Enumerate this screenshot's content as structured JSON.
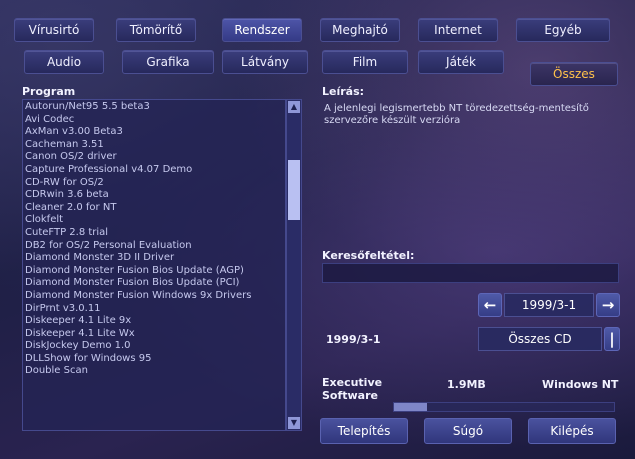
{
  "tabs_row1": [
    {
      "label": "Vírusirtó",
      "active": false
    },
    {
      "label": "Tömörítő",
      "active": false
    },
    {
      "label": "Rendszer",
      "active": true
    },
    {
      "label": "Meghajtó",
      "active": false
    },
    {
      "label": "Internet",
      "active": false
    },
    {
      "label": "Egyéb",
      "active": false
    }
  ],
  "tabs_row2": [
    {
      "label": "Audio",
      "active": false
    },
    {
      "label": "Grafika",
      "active": false
    },
    {
      "label": "Látvány",
      "active": false
    },
    {
      "label": "Film",
      "active": false
    },
    {
      "label": "Játék",
      "active": false
    },
    {
      "label": "Összes",
      "active": true
    }
  ],
  "program_list": {
    "header": "Program",
    "selected_index": 23,
    "items": [
      "Autorun/Net95 5.5 beta3",
      "Avi Codec",
      "AxMan v3.00 Beta3",
      "Cacheman 3.51",
      "Canon OS/2 driver",
      "Capture Professional v4.07 Demo",
      "CD-RW for OS/2",
      "CDRwin 3.6 beta",
      "Cleaner 2.0 for NT",
      "Clokfelt",
      "CuteFTP 2.8 trial",
      "DB2 for OS/2 Personal Evaluation",
      "Diamond Monster 3D II Driver",
      "Diamond Monster Fusion Bios Update (AGP)",
      "Diamond Monster Fusion Bios Update (PCI)",
      "Diamond Monster Fusion Windows 9x Drivers",
      "DirPrnt v3.0.11",
      "Diskeeper 4.1 Lite 9x",
      "Diskeeper 4.1 Lite Wx",
      "DiskJockey Demo 1.0",
      "DLLShow for Windows 95",
      "Double Scan"
    ]
  },
  "description": {
    "label": "Leírás:",
    "text": "A jelenlegi legismertebb NT töredezettség-mentesítő szervezőre készült verzióra"
  },
  "search": {
    "label": "Keresőfeltétel:",
    "value": ""
  },
  "date_nav": {
    "value": "1999/3-1",
    "prev_icon": "left-arrow-icon",
    "next_icon": "right-arrow-icon"
  },
  "cd_selector": {
    "date": "1999/3-1",
    "value": "Összes CD"
  },
  "details": {
    "publisher": "Executive Software",
    "size": "1.9MB",
    "platform": "Windows NT",
    "progress": 0.15
  },
  "buttons": {
    "install": "Telepítés",
    "help": "Súgó",
    "exit": "Kilépés"
  },
  "colors": {
    "selection": "#5a6fd0",
    "accent_orange": "#ffc24a",
    "tab_bg": "#27295c"
  }
}
